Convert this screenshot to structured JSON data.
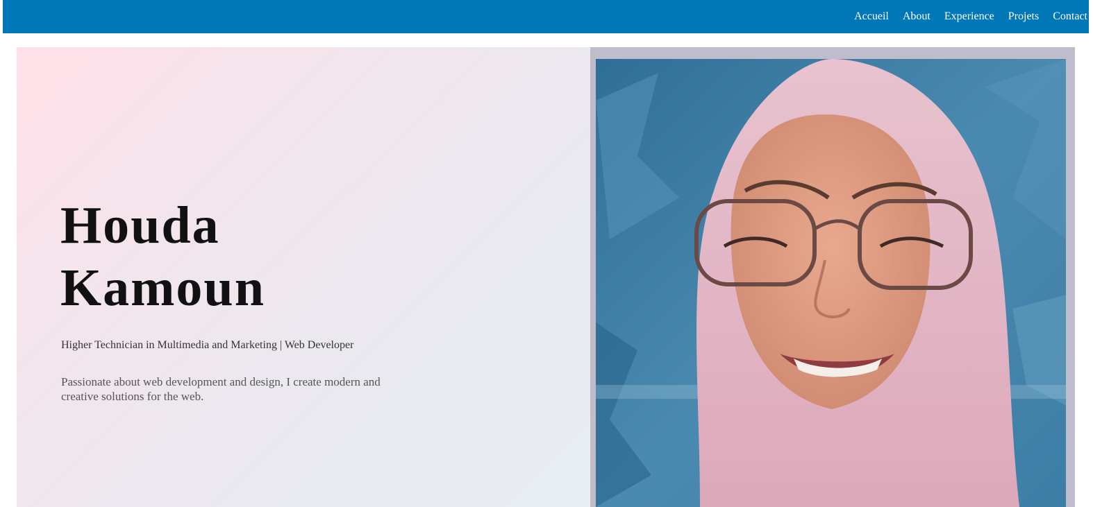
{
  "nav": {
    "items": [
      {
        "label": "Accueil"
      },
      {
        "label": "About"
      },
      {
        "label": "Experience"
      },
      {
        "label": "Projets"
      },
      {
        "label": "Contact"
      }
    ]
  },
  "hero": {
    "name_line1": "Houda",
    "name_line2": "Kamoun",
    "subtitle": "Higher Technician in Multimedia and Marketing | Web Developer",
    "description": "Passionate about web development and design, I create modern and creative solutions for the web."
  },
  "colors": {
    "navbar": "#0077b6",
    "photo_frame": "#c1bccb"
  },
  "icons": {
    "profile_photo": "portrait-photo"
  }
}
